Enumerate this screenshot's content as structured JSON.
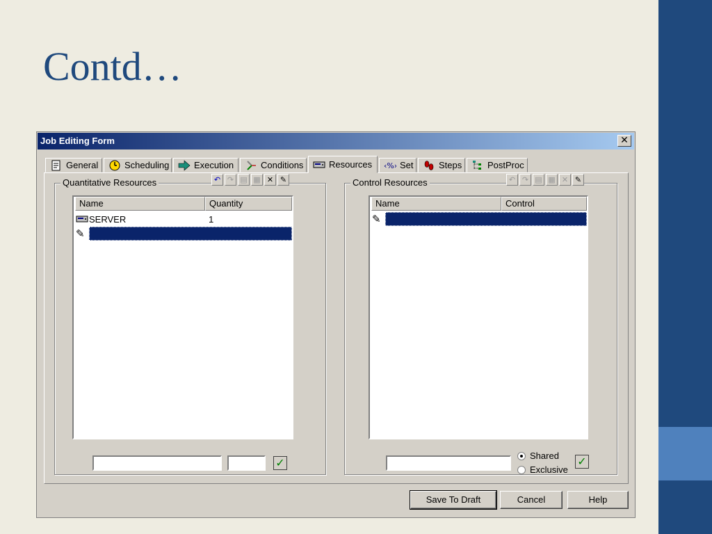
{
  "slide": {
    "title": "Contd…"
  },
  "window": {
    "title": "Job Editing Form",
    "close_glyph": "✕"
  },
  "tabs": [
    {
      "label": "General",
      "icon": "form-icon"
    },
    {
      "label": "Scheduling",
      "icon": "clock-icon"
    },
    {
      "label": "Execution",
      "icon": "arrow-right-icon"
    },
    {
      "label": "Conditions",
      "icon": "branch-icon"
    },
    {
      "label": "Resources",
      "icon": "server-icon",
      "active": true
    },
    {
      "label": "Set",
      "icon": "percent-icon"
    },
    {
      "label": "Steps",
      "icon": "footsteps-icon"
    },
    {
      "label": "PostProc",
      "icon": "tree-icon"
    }
  ],
  "quantitative": {
    "label": "Quantitative Resources",
    "columns": [
      "Name",
      "Quantity"
    ],
    "rows": [
      {
        "name": "SERVER",
        "quantity": "1"
      }
    ],
    "name_value": "",
    "qty_value": ""
  },
  "control": {
    "label": "Control Resources",
    "columns": [
      "Name",
      "Control"
    ],
    "rows": [],
    "name_value": "",
    "options": [
      "Shared",
      "Exclusive"
    ],
    "selected": "Shared"
  },
  "buttons": {
    "save_draft": "Save To Draft",
    "cancel": "Cancel",
    "help": "Help"
  },
  "colors": {
    "sidebar": "#1f497d",
    "sidebar_accent": "#4f81bd",
    "selection": "#0a246a",
    "title": "#1f497d"
  }
}
